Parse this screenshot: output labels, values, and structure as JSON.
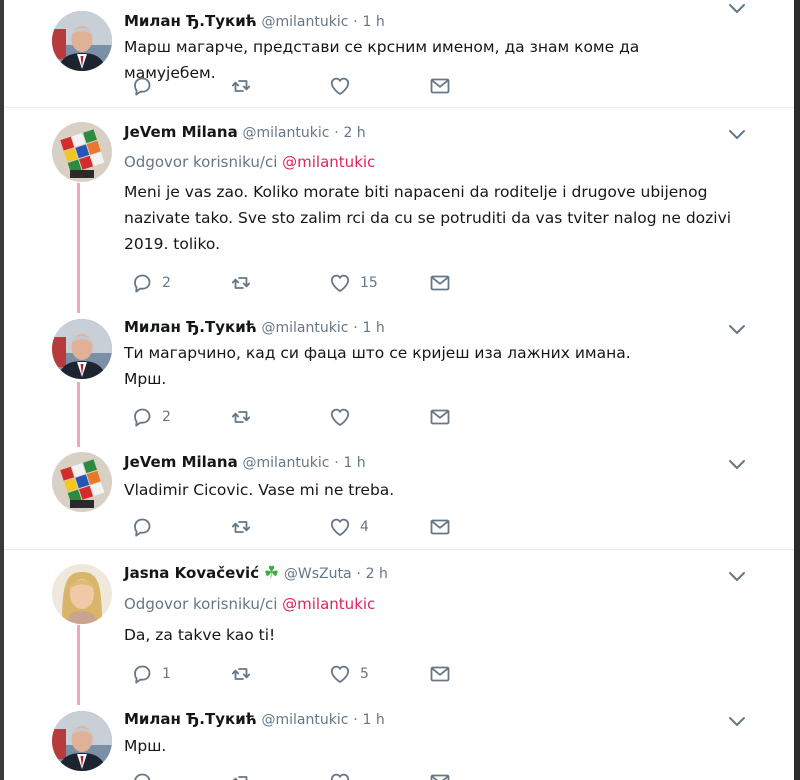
{
  "colors": {
    "accent": "#e0245e",
    "thread": "#f3a6b9",
    "muted": "#657786"
  },
  "tweets": [
    {
      "name": "Милан Ђ.Тукић",
      "handle": "@milantukic",
      "dot": "·",
      "time": "1 h",
      "text": "Марш магарче, представи се крсним именом, да знам коме да мамујебем.",
      "reply": "",
      "retweet": "",
      "like": ""
    },
    {
      "name": "JeVem Milana",
      "handle": "@milantukic",
      "dot": "·",
      "time": "2 h",
      "reply_prefix": "Odgovor korisniku/ci",
      "reply_target": "@milantukic",
      "text": "Meni je vas zao. Koliko morate biti napaceni da roditelje i drugove ubijenog\nnazivate tako. Sve sto zalim rci da cu se potruditi da vas tviter nalog ne dozivi\n2019. toliko.",
      "reply": "2",
      "retweet": "",
      "like": "15"
    },
    {
      "name": "Милан Ђ.Тукић",
      "handle": "@milantukic",
      "dot": "·",
      "time": "1 h",
      "text": "Ти магарчино, кад си фаца што се кријеш иза лажних имана.\nМрш.",
      "reply": "2",
      "retweet": "",
      "like": ""
    },
    {
      "name": "JeVem Milana",
      "handle": "@milantukic",
      "dot": "·",
      "time": "1 h",
      "text": "Vladimir Cicovic. Vase mi ne treba.",
      "reply": "",
      "retweet": "",
      "like": "4"
    },
    {
      "name": "Jasna Kovačević",
      "handle": "@WsZuta",
      "dot": "·",
      "time": "2 h",
      "reply_prefix": "Odgovor korisniku/ci",
      "reply_target": "@milantukic",
      "text": "Da,  za takve kao ti!",
      "reply": "1",
      "retweet": "",
      "like": "5"
    },
    {
      "name": "Милан Ђ.Тукић",
      "handle": "@milantukic",
      "dot": "·",
      "time": "1 h",
      "text": "Мрш.",
      "reply": "",
      "retweet": "",
      "like": ""
    }
  ]
}
